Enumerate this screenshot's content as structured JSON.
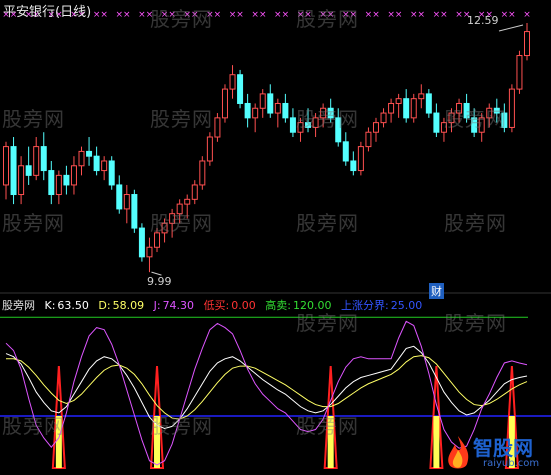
{
  "title": "平安银行(日线)",
  "watermark": "股旁网",
  "finance_badge": "财",
  "indicator_bar": {
    "name": "股旁网",
    "k_label": "K:",
    "k_value": "63.50",
    "d_label": "D:",
    "d_value": "58.09",
    "j_label": "J:",
    "j_value": "74.30",
    "low_buy_label": "低买:",
    "low_buy_value": "0.00",
    "high_sell_label": "高卖:",
    "high_sell_value": "120.00",
    "ma_label": "上涨分界:",
    "ma_value": "25.00"
  },
  "logo": {
    "name": "智股网",
    "url": "raiyub.com"
  },
  "colors": {
    "up": "#ff5050",
    "down": "#54ffff",
    "k_line": "#ffffff",
    "d_line": "#ffff66",
    "j_line": "#dd55ff",
    "high_sell_line": "#22cc22",
    "low_buy_line": "#2222ff",
    "signal": "#ff2020",
    "signal_fill": "#ffff55",
    "top_marks": "#ff55ff"
  },
  "chart_data": [
    {
      "type": "candlestick",
      "title": "平安银行(日线)",
      "annotations": [
        {
          "label": "12.59",
          "kind": "high"
        },
        {
          "label": "9.99",
          "kind": "low"
        }
      ],
      "candles": [
        [
          10.9,
          11.35,
          10.75,
          11.3
        ],
        [
          11.3,
          11.4,
          10.7,
          10.8
        ],
        [
          10.8,
          11.2,
          10.7,
          11.1
        ],
        [
          11.1,
          11.3,
          10.9,
          11.0
        ],
        [
          11.0,
          11.4,
          10.95,
          11.3
        ],
        [
          11.3,
          11.45,
          10.95,
          11.05
        ],
        [
          11.05,
          11.15,
          10.7,
          10.8
        ],
        [
          10.8,
          11.05,
          10.7,
          11.0
        ],
        [
          11.0,
          11.1,
          10.8,
          10.9
        ],
        [
          10.9,
          11.2,
          10.8,
          11.1
        ],
        [
          11.1,
          11.3,
          11.0,
          11.25
        ],
        [
          11.25,
          11.4,
          11.1,
          11.2
        ],
        [
          11.2,
          11.3,
          11.0,
          11.05
        ],
        [
          11.05,
          11.2,
          10.95,
          11.15
        ],
        [
          11.15,
          11.2,
          10.85,
          10.9
        ],
        [
          10.9,
          11.0,
          10.6,
          10.65
        ],
        [
          10.65,
          10.9,
          10.5,
          10.8
        ],
        [
          10.8,
          10.85,
          10.4,
          10.45
        ],
        [
          10.45,
          10.5,
          10.1,
          10.15
        ],
        [
          10.15,
          10.35,
          9.99,
          10.25
        ],
        [
          10.25,
          10.45,
          10.2,
          10.4
        ],
        [
          10.4,
          10.55,
          10.3,
          10.5
        ],
        [
          10.5,
          10.65,
          10.35,
          10.6
        ],
        [
          10.6,
          10.75,
          10.5,
          10.7
        ],
        [
          10.7,
          10.8,
          10.55,
          10.75
        ],
        [
          10.75,
          10.95,
          10.7,
          10.9
        ],
        [
          10.9,
          11.2,
          10.85,
          11.15
        ],
        [
          11.15,
          11.45,
          11.1,
          11.4
        ],
        [
          11.4,
          11.65,
          11.35,
          11.6
        ],
        [
          11.6,
          11.95,
          11.55,
          11.9
        ],
        [
          11.9,
          12.15,
          11.8,
          12.05
        ],
        [
          12.05,
          12.1,
          11.7,
          11.75
        ],
        [
          11.75,
          11.85,
          11.5,
          11.6
        ],
        [
          11.6,
          11.75,
          11.45,
          11.7
        ],
        [
          11.7,
          11.9,
          11.6,
          11.85
        ],
        [
          11.85,
          11.95,
          11.6,
          11.65
        ],
        [
          11.65,
          11.8,
          11.5,
          11.75
        ],
        [
          11.75,
          11.85,
          11.55,
          11.6
        ],
        [
          11.6,
          11.7,
          11.4,
          11.45
        ],
        [
          11.45,
          11.6,
          11.35,
          11.55
        ],
        [
          11.55,
          11.7,
          11.45,
          11.5
        ],
        [
          11.5,
          11.65,
          11.4,
          11.6
        ],
        [
          11.6,
          11.75,
          11.5,
          11.7
        ],
        [
          11.7,
          11.8,
          11.55,
          11.6
        ],
        [
          11.6,
          11.7,
          11.3,
          11.35
        ],
        [
          11.35,
          11.45,
          11.1,
          11.15
        ],
        [
          11.15,
          11.25,
          11.0,
          11.05
        ],
        [
          11.05,
          11.35,
          11.0,
          11.3
        ],
        [
          11.3,
          11.5,
          11.25,
          11.45
        ],
        [
          11.45,
          11.6,
          11.35,
          11.55
        ],
        [
          11.55,
          11.7,
          11.5,
          11.65
        ],
        [
          11.65,
          11.8,
          11.55,
          11.75
        ],
        [
          11.75,
          11.85,
          11.6,
          11.8
        ],
        [
          11.8,
          11.9,
          11.55,
          11.6
        ],
        [
          11.6,
          11.85,
          11.55,
          11.8
        ],
        [
          11.8,
          11.95,
          11.7,
          11.85
        ],
        [
          11.85,
          11.9,
          11.6,
          11.65
        ],
        [
          11.65,
          11.75,
          11.4,
          11.45
        ],
        [
          11.45,
          11.6,
          11.35,
          11.55
        ],
        [
          11.55,
          11.7,
          11.45,
          11.65
        ],
        [
          11.65,
          11.8,
          11.55,
          11.75
        ],
        [
          11.75,
          11.85,
          11.55,
          11.6
        ],
        [
          11.6,
          11.7,
          11.4,
          11.45
        ],
        [
          11.45,
          11.65,
          11.35,
          11.6
        ],
        [
          11.6,
          11.75,
          11.5,
          11.7
        ],
        [
          11.7,
          11.8,
          11.55,
          11.65
        ],
        [
          11.65,
          11.75,
          11.45,
          11.5
        ],
        [
          11.5,
          11.95,
          11.45,
          11.9
        ],
        [
          11.9,
          12.3,
          11.85,
          12.25
        ],
        [
          12.25,
          12.59,
          12.2,
          12.5
        ]
      ]
    },
    {
      "type": "line",
      "title": "",
      "reference_lines": [
        {
          "name": "高卖",
          "value": 120
        },
        {
          "name": "上涨分界",
          "value": 25
        }
      ],
      "series": [
        {
          "name": "K",
          "values": [
            85,
            82,
            75,
            62,
            48,
            38,
            30,
            28,
            34,
            46,
            58,
            70,
            78,
            82,
            80,
            74,
            64,
            52,
            38,
            24,
            16,
            13,
            15,
            22,
            32,
            44,
            56,
            68,
            76,
            80,
            82,
            78,
            72,
            66,
            60,
            55,
            50,
            46,
            40,
            34,
            30,
            28,
            30,
            36,
            44,
            52,
            58,
            62,
            64,
            66,
            68,
            70,
            80,
            90,
            92,
            86,
            76,
            62,
            48,
            38,
            30,
            26,
            28,
            34,
            40,
            48,
            56,
            60,
            62,
            63.5
          ]
        },
        {
          "name": "D",
          "values": [
            80,
            80,
            78,
            72,
            64,
            55,
            47,
            40,
            37,
            40,
            46,
            54,
            62,
            69,
            73,
            74,
            71,
            65,
            56,
            45,
            35,
            28,
            23,
            22,
            25,
            31,
            39,
            48,
            57,
            65,
            71,
            73,
            73,
            71,
            67,
            63,
            59,
            55,
            50,
            45,
            40,
            36,
            34,
            34,
            37,
            42,
            47,
            52,
            56,
            59,
            62,
            65,
            70,
            77,
            82,
            83,
            81,
            75,
            66,
            57,
            48,
            41,
            36,
            35,
            37,
            41,
            46,
            51,
            55,
            58.09
          ]
        },
        {
          "name": "J",
          "values": [
            95,
            88,
            70,
            42,
            16,
            4,
            -5,
            4,
            28,
            58,
            82,
            102,
            110,
            108,
            94,
            74,
            50,
            26,
            2,
            -18,
            -22,
            -18,
            -2,
            22,
            46,
            70,
            90,
            108,
            114,
            110,
            104,
            88,
            70,
            56,
            46,
            39,
            32,
            28,
            20,
            12,
            10,
            12,
            22,
            40,
            58,
            72,
            80,
            82,
            80,
            80,
            80,
            80,
            100,
            116,
            112,
            92,
            66,
            36,
            12,
            0,
            -6,
            -4,
            12,
            32,
            46,
            62,
            76,
            78,
            76,
            74.3
          ]
        }
      ],
      "signals": [
        7,
        20,
        43,
        57,
        67
      ]
    }
  ]
}
